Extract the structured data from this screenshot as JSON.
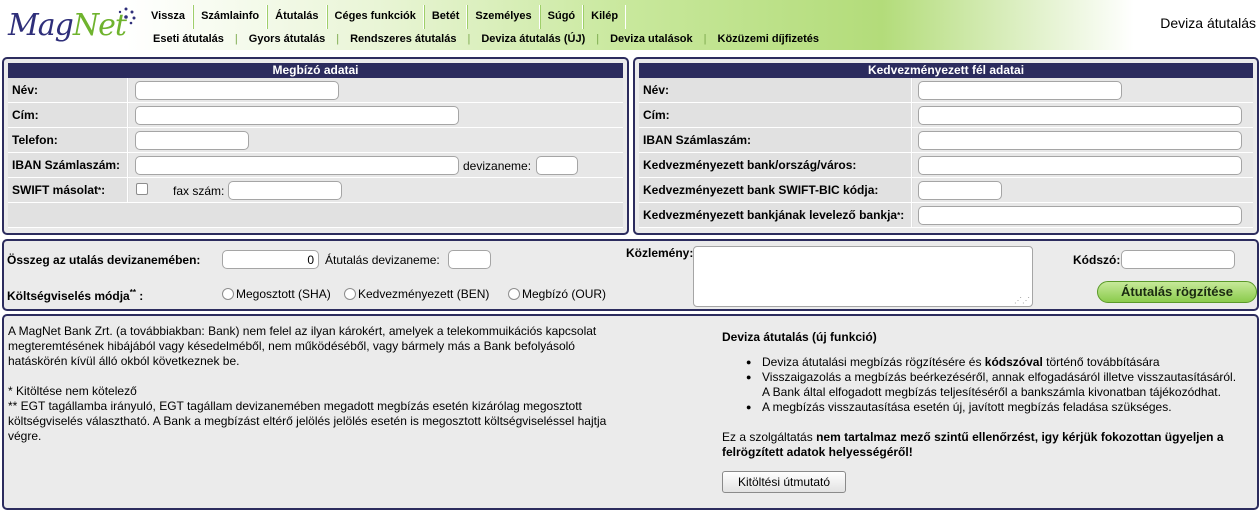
{
  "header": {
    "logo": {
      "part1": "Mag",
      "part2": "Net"
    },
    "nav_main": [
      "Vissza",
      "Számlainfo",
      "Átutalás",
      "Céges funkciók",
      "Betét",
      "Személyes",
      "Súgó",
      "Kilép"
    ],
    "nav_sub": [
      "Eseti átutalás",
      "Gyors átutalás",
      "Rendszeres átutalás",
      "Deviza átutalás (ÚJ)",
      "Deviza utalások",
      "Közüzemi díjfizetés"
    ],
    "page_title": "Deviza átutalás"
  },
  "megbizo": {
    "title": "Megbízó adatai",
    "name_label": "Név:",
    "address_label": "Cím:",
    "phone_label": "Telefon:",
    "iban_label": "IBAN Számlaszám:",
    "currency_label": "devizaneme:",
    "swift_label": "SWIFT másolat",
    "swift_mark": "*",
    "swift_colon": ":",
    "fax_label": "fax szám:"
  },
  "kedvezmenyezett": {
    "title": "Kedvezményezett fél adatai",
    "name_label": "Név:",
    "address_label": "Cím:",
    "iban_label": "IBAN Számlaszám:",
    "bank_label": "Kedvezményezett bank/ország/város:",
    "swift_label": "Kedvezményezett bank SWIFT-BIC kódja:",
    "corr_label": "Kedvezményezett bankjának levelező bankja",
    "corr_mark": "*",
    "corr_colon": ":"
  },
  "transfer": {
    "amount_label": "Összeg az utalás devizanemében:",
    "amount_value": "0",
    "currency_label": "Átutalás devizaneme:",
    "cost_label": "Költségviselés módja",
    "cost_mark": "**",
    "cost_colon": " :",
    "options": [
      "Megosztott (SHA)",
      "Kedvezményezett (BEN)",
      "Megbízó (OUR)"
    ],
    "note_label": "Közlemény:",
    "code_label": "Kódszó:",
    "submit_label": "Átutalás rögzítése"
  },
  "info": {
    "disclaimer": "A MagNet Bank Zrt. (a továbbiakban: Bank) nem felel az ilyan károkért, amelyek a telekommuikációs kapcsolat megteremtésének hibájából vagy késedelméből, nem működéséből, vagy bármely más a Bank befolyásoló hatáskörén kívül álló okból következnek be.",
    "note1": "* Kitöltése nem kötelező",
    "note2": "** EGT tagállamba irányuló, EGT tagállam devizanemében megadott megbízás esetén kizárólag megosztott költségviselés választható. A Bank a megbízást eltérő jelölés jelölés esetén is megosztott költségviseléssel hajtja végre.",
    "feature_title": "Deviza átutalás (új funkció)",
    "bullet1_pre": "Deviza átutalási megbízás rögzítésére és ",
    "bullet1_bold": "kódszóval",
    "bullet1_post": " történő továbbítására",
    "bullet2a": "Visszaigazolás a megbízás beérkezéséről, annak elfogadásáról illetve visszautasításáról.",
    "bullet2b": "A Bank által elfogadott megbízás teljesítéséről a bankszámla kivonatban tájékozódhat.",
    "bullet3": "A megbízás visszautasítása esetén új, javított megbízás feladása szükséges.",
    "warn_pre": "Ez a szolgáltatás ",
    "warn_bold": "nem tartalmaz mező szintű ellenőrzést, igy kérjük fokozottan ügyeljen a felrögzített adatok helyességéről!",
    "guide_button": "Kitöltési útmutató"
  }
}
